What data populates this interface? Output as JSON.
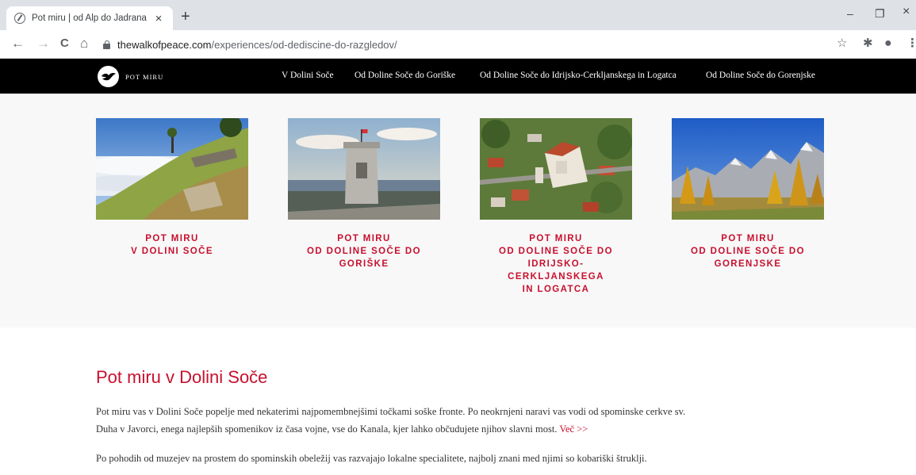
{
  "browser": {
    "tab_title": "Pot miru | od Alp do Jadrana",
    "tab_close": "×",
    "new_tab": "+",
    "url_domain": "thewalkofpeace.com",
    "url_path": "/experiences/od-dediscine-do-razgledov/",
    "back": "←",
    "forward": "→",
    "reload": "C",
    "home": "⌂",
    "minimize": "–",
    "restore": "❐",
    "close": "×",
    "star": "☆",
    "extensions": "✱",
    "profile": "●",
    "menu": "⋮"
  },
  "site": {
    "logo_text": "POT MIRU",
    "nav": [
      {
        "label": "V Dolini Soče"
      },
      {
        "label": "Od Doline Soče do Goriške"
      },
      {
        "label": "Od Doline Soče do Idrijsko-Cerkljanskega in Logatca"
      },
      {
        "label": "Od Doline Soče do Gorenjske"
      }
    ]
  },
  "cards": [
    {
      "line1": "POT MIRU",
      "line2": "V DOLINI SOČE",
      "line3": "",
      "line4": ""
    },
    {
      "line1": "POT MIRU",
      "line2": "OD DOLINE SOČE DO",
      "line3": "GORIŠKE",
      "line4": ""
    },
    {
      "line1": "POT MIRU",
      "line2": "OD DOLINE SOČE DO",
      "line3": "IDRIJSKO-CERKLJANSKEGA",
      "line4": "IN LOGATCA"
    },
    {
      "line1": "POT MIRU",
      "line2": "OD DOLINE SOČE DO",
      "line3": "GORENJSKE",
      "line4": ""
    }
  ],
  "intro": {
    "title": "Pot miru v Dolini Soče",
    "p1_line1": "Pot miru vas v Dolini Soče popelje med nekaterimi najpomembnejšimi točkami soške fronte. Po neokrnjeni naravi vas vodi od spominske cerkve sv.",
    "p1_line2": "Duha v Javorci, enega najlepših spomenikov iz časa vojne, vse do Kanala, kjer lahko občudujete njihov slavni most.",
    "more": "Več >>",
    "p2": "Po pohodih od muzejev na prostem do spominskih obeležij vas razvajajo lokalne specialitete, najbolj znani med njimi so kobariški štruklji."
  },
  "colors": {
    "accent": "#c8102e",
    "header_bg": "#000000",
    "section_bg": "#f8f8f8"
  }
}
